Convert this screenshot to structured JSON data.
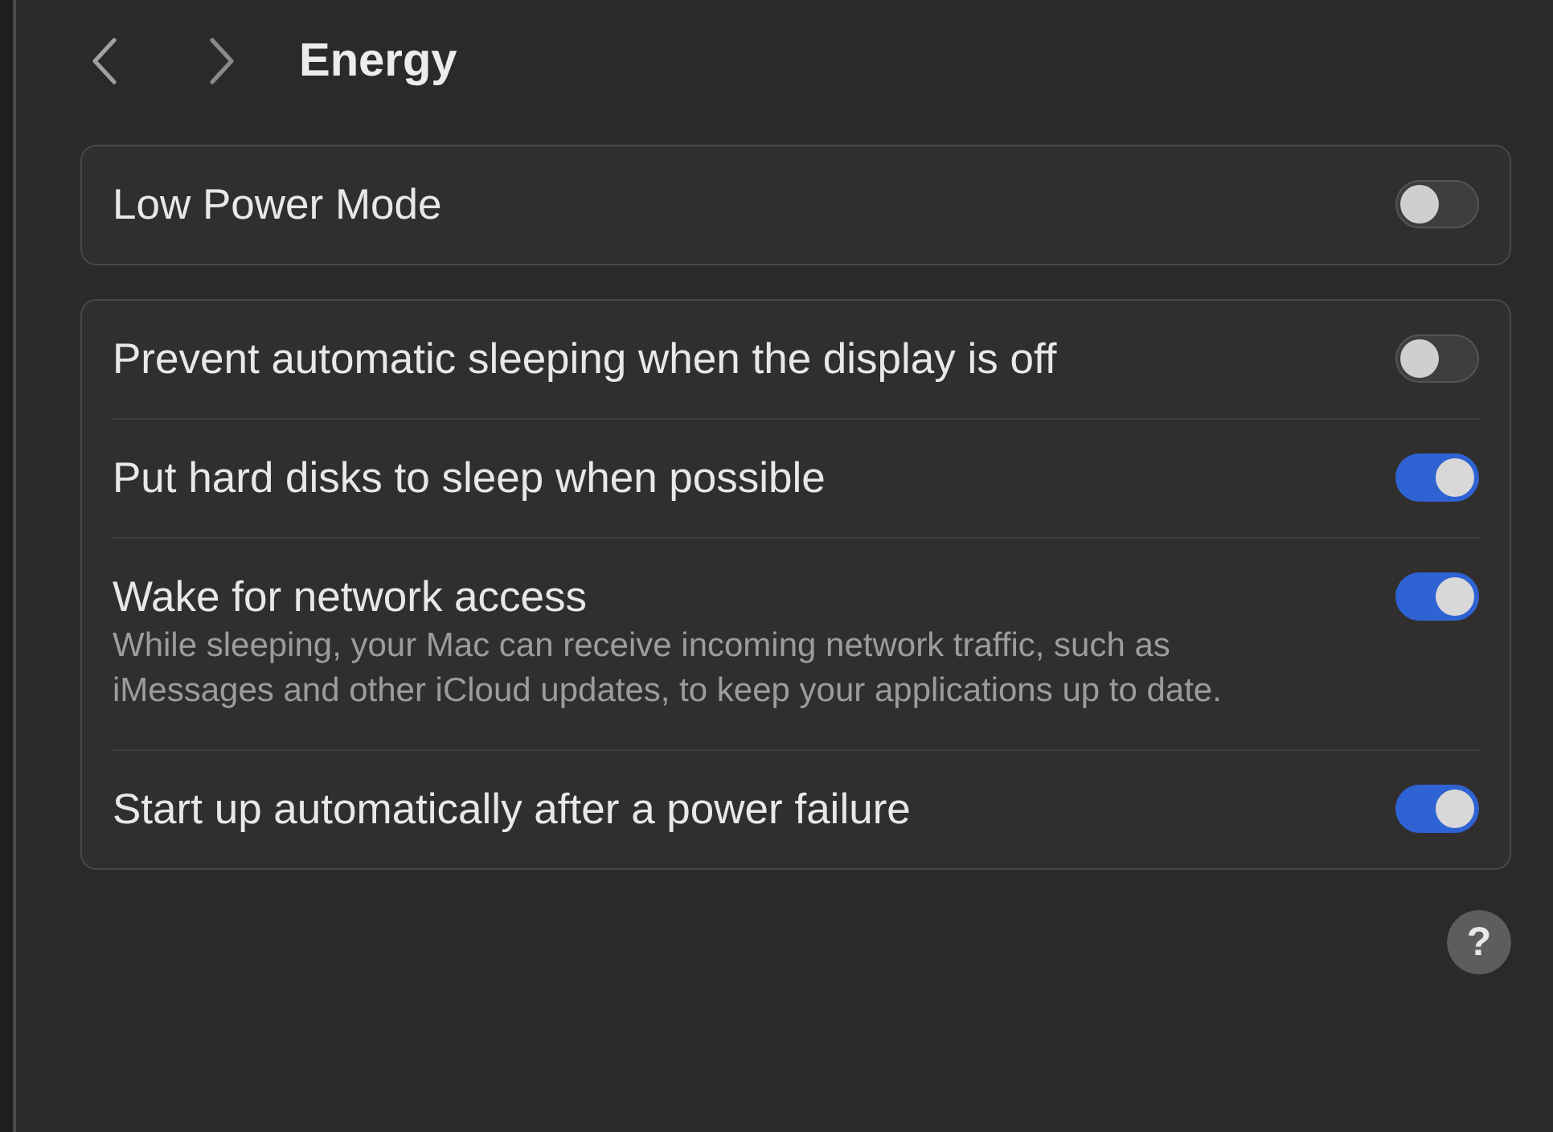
{
  "header": {
    "title": "Energy"
  },
  "groups": [
    {
      "rows": [
        {
          "label": "Low Power Mode",
          "on": false
        }
      ]
    },
    {
      "rows": [
        {
          "label": "Prevent automatic sleeping when the display is off",
          "on": false
        },
        {
          "label": "Put hard disks to sleep when possible",
          "on": true
        },
        {
          "label": "Wake for network access",
          "description": "While sleeping, your Mac can receive incoming network traffic, such as iMessages and other iCloud updates, to keep your applications up to date.",
          "on": true
        },
        {
          "label": "Start up automatically after a power failure",
          "on": true
        }
      ]
    }
  ],
  "help": {
    "label": "?"
  }
}
